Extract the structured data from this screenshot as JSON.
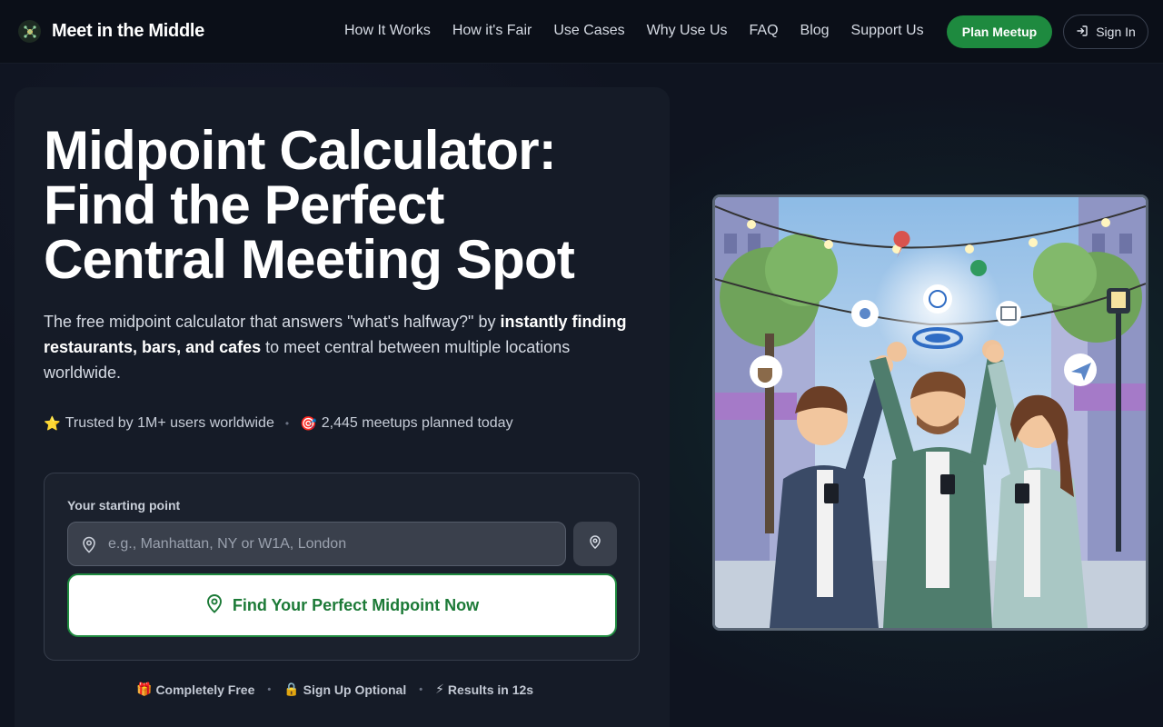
{
  "brand": {
    "name": "Meet in the Middle"
  },
  "nav": {
    "links": [
      "How It Works",
      "How it's Fair",
      "Use Cases",
      "Why Use Us",
      "FAQ",
      "Blog",
      "Support Us"
    ],
    "cta": "Plan Meetup",
    "signin": "Sign In"
  },
  "hero": {
    "title_line1": "Midpoint Calculator:",
    "title_line2": "Find the Perfect",
    "title_line3": "Central Meeting Spot",
    "desc_pre": "The free midpoint calculator that answers \"what's halfway?\" by ",
    "desc_bold": "instantly finding restaurants, bars, and cafes",
    "desc_post": " to meet central between multiple locations worldwide."
  },
  "trust": {
    "users": "Trusted by 1M+ users worldwide",
    "meetups": "2,445 meetups planned today",
    "users_icon": "star-icon",
    "meetups_icon": "target-icon"
  },
  "form": {
    "label": "Your starting point",
    "placeholder": "e.g., Manhattan, NY or W1A, London",
    "value": "",
    "submit": "Find Your Perfect Midpoint Now"
  },
  "perks": [
    {
      "icon": "gift-icon",
      "label": "Completely Free"
    },
    {
      "icon": "lock-icon",
      "label": "Sign Up Optional"
    },
    {
      "icon": "lightning-icon",
      "label": "Results in 12s"
    }
  ],
  "colors": {
    "accent": "#1e8a3f",
    "background": "#0f1420",
    "card": "#151b27"
  }
}
